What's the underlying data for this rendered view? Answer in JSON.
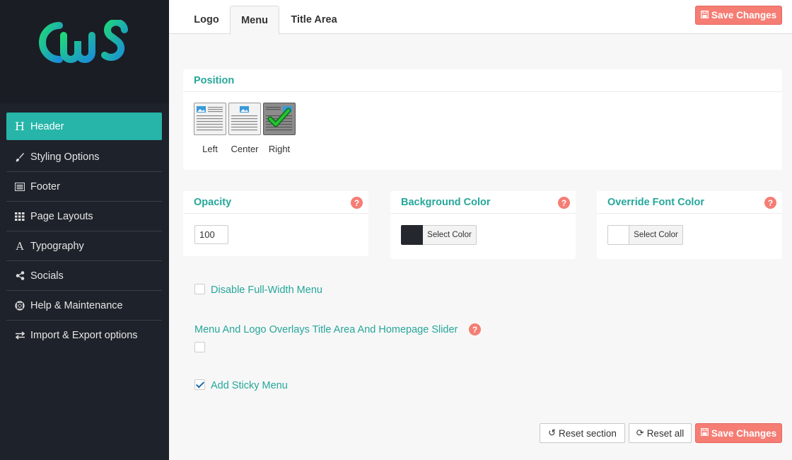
{
  "sidebar": {
    "logo": "CwS",
    "items": [
      {
        "label": "Header",
        "icon": "header-icon",
        "glyph": "H"
      },
      {
        "label": "Styling Options",
        "icon": "brush-icon",
        "glyph": "✎"
      },
      {
        "label": "Footer",
        "icon": "list-alt-icon",
        "glyph": "▤"
      },
      {
        "label": "Page Layouts",
        "icon": "grid-icon",
        "glyph": "⁞⁞⁞"
      },
      {
        "label": "Typography",
        "icon": "font-icon",
        "glyph": "A"
      },
      {
        "label": "Socials",
        "icon": "share-icon",
        "glyph": "⋖"
      },
      {
        "label": "Help & Maintenance",
        "icon": "lifebuoy-icon",
        "glyph": "⊕"
      },
      {
        "label": "Import & Export options",
        "icon": "exchange-icon",
        "glyph": "⇄"
      }
    ]
  },
  "tabs": [
    {
      "label": "Logo"
    },
    {
      "label": "Menu"
    },
    {
      "label": "Title Area"
    }
  ],
  "toolbar": {
    "save_label": "Save Changes",
    "reset_section_label": "Reset section",
    "reset_all_label": "Reset all"
  },
  "position": {
    "title": "Position",
    "options": [
      {
        "label": "Left"
      },
      {
        "label": "Center"
      },
      {
        "label": "Right"
      }
    ],
    "selected": "Right"
  },
  "opacity": {
    "title": "Opacity",
    "value": "100"
  },
  "background_color": {
    "title": "Background Color",
    "button_label": "Select Color",
    "swatch": "#25272e"
  },
  "font_color": {
    "title": "Override Font Color",
    "button_label": "Select Color",
    "swatch": "#ffffff"
  },
  "options": {
    "disable_full_width": {
      "label": "Disable Full-Width Menu",
      "checked": false
    },
    "overlay": {
      "label": "Menu And Logo Overlays Title Area And Homepage Slider",
      "checked": false
    },
    "sticky": {
      "label": "Add Sticky Menu",
      "checked": true
    }
  },
  "colors": {
    "accent": "#26b5a8",
    "save": "#f57d74",
    "sidebar": "#1e222a"
  }
}
